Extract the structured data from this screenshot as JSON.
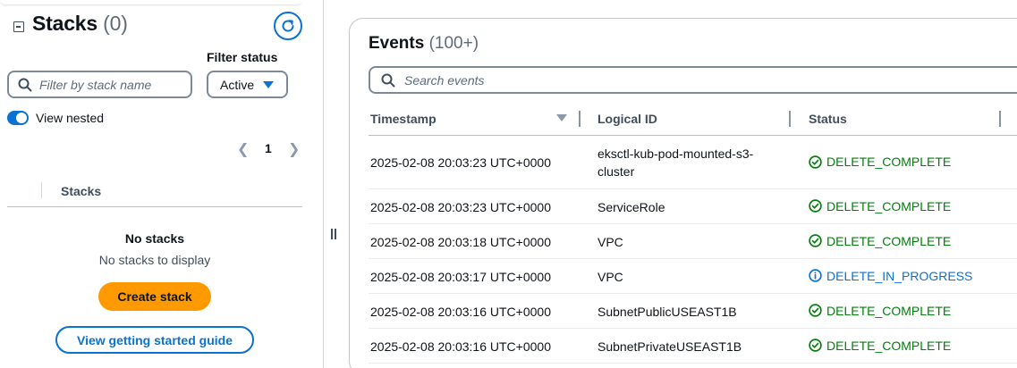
{
  "left_panel": {
    "title": "Stacks",
    "count": "(0)",
    "filter_status_label": "Filter status",
    "search_placeholder": "Filter by stack name",
    "filter_value": "Active",
    "view_nested_label": "View nested",
    "view_nested_on": true,
    "page_number": "1",
    "column_header": "Stacks",
    "empty_title": "No stacks",
    "empty_subtitle": "No stacks to display",
    "create_button": "Create stack",
    "guide_button": "View getting started guide"
  },
  "events": {
    "title": "Events",
    "count": "(100+)",
    "search_placeholder": "Search events",
    "columns": [
      "Timestamp",
      "Logical ID",
      "Status"
    ],
    "rows": [
      {
        "timestamp": "2025-02-08 20:03:23 UTC+0000",
        "logical_id": "eksctl-kub-pod-mounted-s3-cluster",
        "status": "DELETE_COMPLETE",
        "status_type": "complete"
      },
      {
        "timestamp": "2025-02-08 20:03:23 UTC+0000",
        "logical_id": "ServiceRole",
        "status": "DELETE_COMPLETE",
        "status_type": "complete"
      },
      {
        "timestamp": "2025-02-08 20:03:18 UTC+0000",
        "logical_id": "VPC",
        "status": "DELETE_COMPLETE",
        "status_type": "complete"
      },
      {
        "timestamp": "2025-02-08 20:03:17 UTC+0000",
        "logical_id": "VPC",
        "status": "DELETE_IN_PROGRESS",
        "status_type": "progress"
      },
      {
        "timestamp": "2025-02-08 20:03:16 UTC+0000",
        "logical_id": "SubnetPublicUSEAST1B",
        "status": "DELETE_COMPLETE",
        "status_type": "complete"
      },
      {
        "timestamp": "2025-02-08 20:03:16 UTC+0000",
        "logical_id": "SubnetPrivateUSEAST1B",
        "status": "DELETE_COMPLETE",
        "status_type": "complete"
      }
    ]
  },
  "colors": {
    "accent": "#0972d3",
    "success": "#037f0c",
    "primary_button": "#ff9900"
  },
  "icons": [
    "collapse-icon",
    "refresh-icon",
    "search-icon",
    "caret-down-icon",
    "chevron-left-icon",
    "chevron-right-icon",
    "check-circle-icon",
    "info-circle-icon",
    "drag-handle-icon"
  ]
}
